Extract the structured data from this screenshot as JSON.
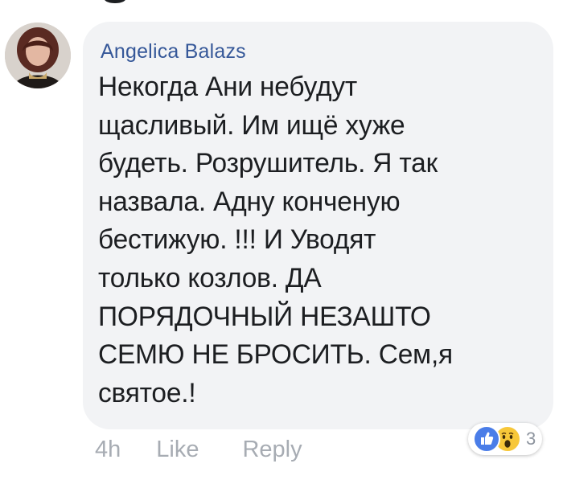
{
  "comment": {
    "author": "Angelica Balazs",
    "text": "Некогда Ани небудут\nщасливый. Им ищё хуже\nбудеть. Розрушитель. Я так\nназвала. Адну конченую\nбестижую. !!! И  Уводят\nтолько козлов. ДА\nПОРЯДОЧНЫЙ НЕЗАШТО\nСЕМЮ НЕ БРОСИТЬ.  Сем,я\nсвятое.!"
  },
  "actions": {
    "time": "4h",
    "like_label": "Like",
    "reply_label": "Reply"
  },
  "reactions": {
    "icons": [
      "like-icon",
      "wow-icon"
    ],
    "count": "3"
  },
  "colors": {
    "author": "#365899",
    "text": "#1c1e21",
    "bubble": "#f2f3f5",
    "actions": "#a7acb3",
    "like": "#4a7de8",
    "wow": "#f7c739"
  }
}
